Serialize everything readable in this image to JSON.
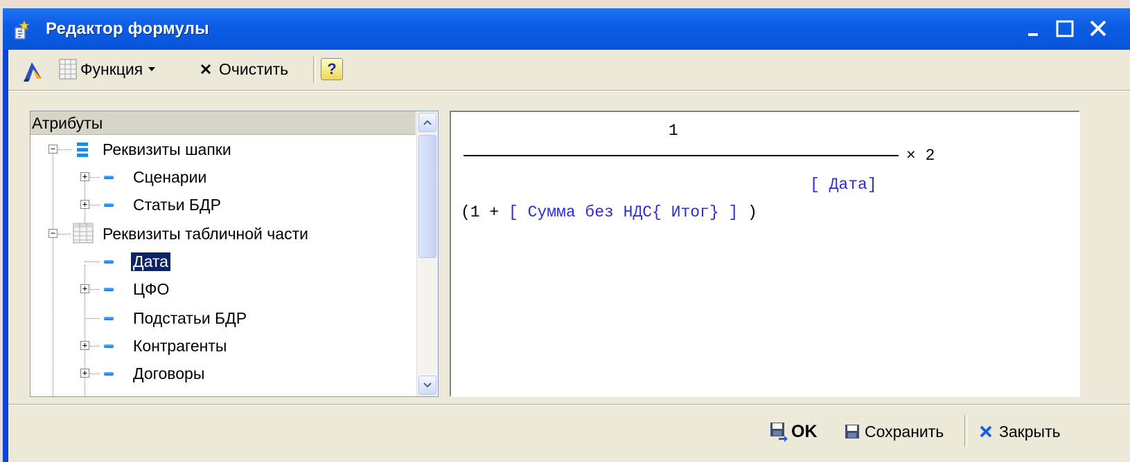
{
  "window": {
    "title": "Редактор формулы",
    "controls": {
      "minimize": "_",
      "maximize": "□",
      "close": "✕"
    }
  },
  "toolbar": {
    "function_label": "Функция",
    "clear_label": "Очистить",
    "help_label": "?"
  },
  "tree": {
    "header": "Атрибуты",
    "items": [
      {
        "label": "Реквизиты шапки",
        "level": 0,
        "expander": "minus"
      },
      {
        "label": "Сценарии",
        "level": 1,
        "expander": "plus"
      },
      {
        "label": "Статьи БДР",
        "level": 1,
        "expander": "plus"
      },
      {
        "label": "Реквизиты табличной части",
        "level": 0,
        "expander": "minus"
      },
      {
        "label": "Дата",
        "level": 1,
        "expander": "none",
        "selected": true
      },
      {
        "label": "ЦФО",
        "level": 1,
        "expander": "plus"
      },
      {
        "label": "Подстатьи БДР",
        "level": 1,
        "expander": "none"
      },
      {
        "label": "Контрагенты",
        "level": 1,
        "expander": "plus"
      },
      {
        "label": "Договоры",
        "level": 1,
        "expander": "plus"
      }
    ]
  },
  "formula": {
    "numerator": "1",
    "multiplier": "× 2",
    "exponent": "[ Дата]",
    "denominator_open": "(1 + ",
    "denominator_attr": "[ Сумма без НДС{ Итог} ]",
    "denominator_close": " )"
  },
  "footer": {
    "ok_label": "OK",
    "save_label": "Сохранить",
    "close_label": "Закрыть"
  },
  "colors": {
    "titlebar": "#0654d8",
    "client": "#ece9d8",
    "formula_attr": "#2b2bd8",
    "selection": "#0a246a"
  }
}
